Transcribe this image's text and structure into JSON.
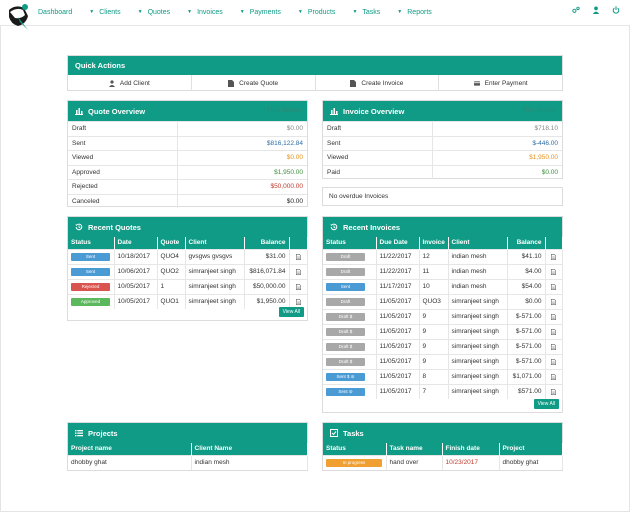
{
  "nav": {
    "items": [
      {
        "label": "Dashboard",
        "caret": false
      },
      {
        "label": "Clients",
        "caret": true
      },
      {
        "label": "Quotes",
        "caret": true
      },
      {
        "label": "Invoices",
        "caret": true
      },
      {
        "label": "Payments",
        "caret": true
      },
      {
        "label": "Products",
        "caret": true
      },
      {
        "label": "Tasks",
        "caret": true
      },
      {
        "label": "Reports",
        "caret": true
      }
    ],
    "right_icons": [
      "settings-icon",
      "user-icon",
      "power-icon"
    ]
  },
  "quick_actions": {
    "title": "Quick Actions",
    "buttons": [
      {
        "label": "Add Client",
        "icon": "user-icon"
      },
      {
        "label": "Create Quote",
        "icon": "file-icon"
      },
      {
        "label": "Create Invoice",
        "icon": "file-icon"
      },
      {
        "label": "Enter Payment",
        "icon": "credit-card-icon"
      }
    ]
  },
  "quote_overview": {
    "title": "Quote Overview",
    "period": "This Month",
    "rows": [
      {
        "label": "Draft",
        "value": "$0.00",
        "color": "gray"
      },
      {
        "label": "Sent",
        "value": "$816,122.84",
        "color": "blue"
      },
      {
        "label": "Viewed",
        "value": "$0.00",
        "color": "orange"
      },
      {
        "label": "Approved",
        "value": "$1,950.00",
        "color": "green"
      },
      {
        "label": "Rejected",
        "value": "$50,000.00",
        "color": "red"
      },
      {
        "label": "Canceled",
        "value": "$0.00",
        "color": "black"
      }
    ]
  },
  "invoice_overview": {
    "title": "Invoice Overview",
    "period": "This Month",
    "rows": [
      {
        "label": "Draft",
        "value": "$718.10",
        "color": "gray"
      },
      {
        "label": "Sent",
        "value": "$-446.00",
        "color": "blue"
      },
      {
        "label": "Viewed",
        "value": "$1,950.00",
        "color": "orange"
      },
      {
        "label": "Paid",
        "value": "$0.00",
        "color": "green"
      }
    ],
    "overdue": "No overdue Invoices"
  },
  "recent_quotes": {
    "title": "Recent Quotes",
    "headers": [
      "Status",
      "Date",
      "Quote",
      "Client",
      "Balance",
      ""
    ],
    "rows": [
      {
        "status": "Sent",
        "cls": "b-sent",
        "date": "10/18/2017",
        "quote": "QUO4",
        "client": "gvsgws gvsgvs",
        "balance": "$31.00"
      },
      {
        "status": "Sent",
        "cls": "b-sent",
        "date": "10/06/2017",
        "quote": "QUO2",
        "client": "simranjeet singh",
        "balance": "$816,071.84"
      },
      {
        "status": "Rejected",
        "cls": "b-rejected",
        "date": "10/05/2017",
        "quote": "1",
        "client": "simranjeet singh",
        "balance": "$50,000.00"
      },
      {
        "status": "Approved",
        "cls": "b-approved",
        "date": "10/05/2017",
        "quote": "QUO1",
        "client": "simranjeet singh",
        "balance": "$1,950.00"
      }
    ],
    "view_all": "View All"
  },
  "recent_invoices": {
    "title": "Recent Invoices",
    "headers": [
      "Status",
      "Due Date",
      "Invoice",
      "Client",
      "Balance",
      ""
    ],
    "rows": [
      {
        "status": "Draft",
        "cls": "b-draft",
        "date": "11/22/2017",
        "invoice": "12",
        "client": "indian mesh",
        "balance": "$41.10"
      },
      {
        "status": "Draft",
        "cls": "b-draft",
        "date": "11/22/2017",
        "invoice": "11",
        "client": "indian mesh",
        "balance": "$4.00"
      },
      {
        "status": "Sent",
        "cls": "b-sent",
        "date": "11/17/2017",
        "invoice": "10",
        "client": "indian mesh",
        "balance": "$54.00"
      },
      {
        "status": "Draft",
        "cls": "b-draft",
        "date": "11/05/2017",
        "invoice": "QUO3",
        "client": "simranjeet singh",
        "balance": "$0.00"
      },
      {
        "status": "Draft $",
        "cls": "b-draft",
        "date": "11/05/2017",
        "invoice": "9",
        "client": "simranjeet singh",
        "balance": "$-571.00"
      },
      {
        "status": "Draft $",
        "cls": "b-draft",
        "date": "11/05/2017",
        "invoice": "9",
        "client": "simranjeet singh",
        "balance": "$-571.00"
      },
      {
        "status": "Draft $",
        "cls": "b-draft",
        "date": "11/05/2017",
        "invoice": "9",
        "client": "simranjeet singh",
        "balance": "$-571.00"
      },
      {
        "status": "Draft $",
        "cls": "b-draft",
        "date": "11/05/2017",
        "invoice": "9",
        "client": "simranjeet singh",
        "balance": "$-571.00"
      },
      {
        "status": "Sent $ ⊘",
        "cls": "b-sent",
        "date": "11/05/2017",
        "invoice": "8",
        "client": "simranjeet singh",
        "balance": "$1,071.00"
      },
      {
        "status": "Sent ⊘",
        "cls": "b-sent",
        "date": "11/05/2017",
        "invoice": "7",
        "client": "simranjeet singh",
        "balance": "$571.00"
      }
    ],
    "view_all": "View All"
  },
  "projects": {
    "title": "Projects",
    "headers": [
      "Project name",
      "Client Name"
    ],
    "rows": [
      {
        "name": "dhobby ghat",
        "client": "indian mesh"
      }
    ]
  },
  "tasks": {
    "title": "Tasks",
    "headers": [
      "Status",
      "Task name",
      "Finish date",
      "Project"
    ],
    "rows": [
      {
        "status": "In progress",
        "task": "hand over",
        "finish": "10/23/2017",
        "project": "dhobby ghat"
      }
    ]
  },
  "colors": {
    "brand": "#0f9b85",
    "sent": "#4a9ad4",
    "rejected": "#d9534f",
    "approved": "#5cb85c",
    "draft": "#a8a8a8",
    "progress": "#f0a030"
  }
}
